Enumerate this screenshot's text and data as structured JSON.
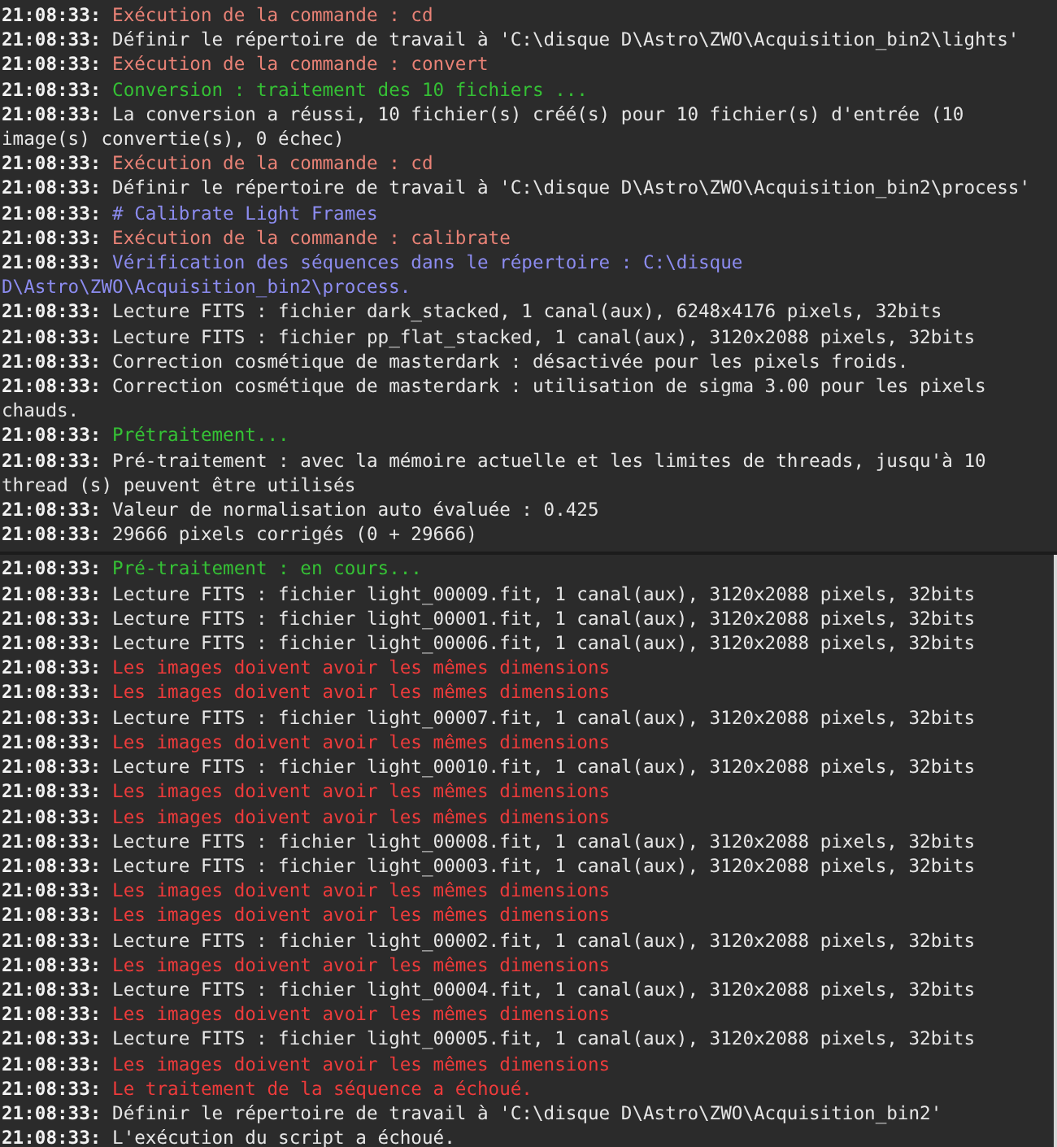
{
  "panels": [
    {
      "lines": [
        {
          "time": "21:08:33:",
          "kind": "command",
          "text": "Exécution de la commande : cd"
        },
        {
          "time": "21:08:33:",
          "kind": "info",
          "text": "Définir le répertoire de travail à 'C:\\disque D\\Astro\\ZWO\\Acquisition_bin2\\lights'"
        },
        {
          "time": "21:08:33:",
          "kind": "command",
          "text": "Exécution de la commande : convert"
        },
        {
          "time": "21:08:33:",
          "kind": "success",
          "text": "Conversion : traitement des 10 fichiers ..."
        },
        {
          "time": "21:08:33:",
          "kind": "info",
          "text": "La conversion a réussi, 10 fichier(s) créé(s) pour 10 fichier(s) d'entrée (10 image(s) convertie(s), 0 échec)"
        },
        {
          "time": "21:08:33:",
          "kind": "command",
          "text": "Exécution de la commande : cd"
        },
        {
          "time": "21:08:33:",
          "kind": "info",
          "text": "Définir le répertoire de travail à 'C:\\disque D\\Astro\\ZWO\\Acquisition_bin2\\process'"
        },
        {
          "time": "21:08:33:",
          "kind": "heading",
          "text": "# Calibrate Light Frames"
        },
        {
          "time": "21:08:33:",
          "kind": "command",
          "text": "Exécution de la commande : calibrate"
        },
        {
          "time": "21:08:33:",
          "kind": "heading",
          "text": "Vérification des séquences dans le répertoire : C:\\disque D\\Astro\\ZWO\\Acquisition_bin2\\process."
        },
        {
          "time": "21:08:33:",
          "kind": "info",
          "text": "Lecture FITS : fichier dark_stacked, 1 canal(aux), 6248x4176 pixels, 32bits"
        },
        {
          "time": "21:08:33:",
          "kind": "info",
          "text": "Lecture FITS : fichier pp_flat_stacked, 1 canal(aux), 3120x2088 pixels, 32bits"
        },
        {
          "time": "21:08:33:",
          "kind": "info",
          "text": "Correction cosmétique de masterdark : désactivée pour les pixels froids."
        },
        {
          "time": "21:08:33:",
          "kind": "info",
          "text": "Correction cosmétique de masterdark : utilisation de sigma 3.00 pour les pixels chauds."
        },
        {
          "time": "21:08:33:",
          "kind": "success",
          "text": "Prétraitement..."
        },
        {
          "time": "21:08:33:",
          "kind": "info",
          "text": "Pré-traitement : avec la mémoire actuelle et les limites de threads, jusqu'à 10 thread (s) peuvent être utilisés"
        },
        {
          "time": "21:08:33:",
          "kind": "info",
          "text": "Valeur de normalisation auto évaluée : 0.425"
        },
        {
          "time": "21:08:33:",
          "kind": "info",
          "text": "29666 pixels corrigés (0 + 29666)"
        }
      ]
    },
    {
      "lines": [
        {
          "time": "21:08:33:",
          "kind": "success",
          "text": "Pré-traitement : en cours..."
        },
        {
          "time": "21:08:33:",
          "kind": "info",
          "text": "Lecture FITS : fichier light_00009.fit, 1 canal(aux), 3120x2088 pixels, 32bits"
        },
        {
          "time": "21:08:33:",
          "kind": "info",
          "text": "Lecture FITS : fichier light_00001.fit, 1 canal(aux), 3120x2088 pixels, 32bits"
        },
        {
          "time": "21:08:33:",
          "kind": "info",
          "text": "Lecture FITS : fichier light_00006.fit, 1 canal(aux), 3120x2088 pixels, 32bits"
        },
        {
          "time": "21:08:33:",
          "kind": "error",
          "text": "Les images doivent avoir les mêmes dimensions"
        },
        {
          "time": "21:08:33:",
          "kind": "error",
          "text": "Les images doivent avoir les mêmes dimensions"
        },
        {
          "time": "21:08:33:",
          "kind": "info",
          "text": "Lecture FITS : fichier light_00007.fit, 1 canal(aux), 3120x2088 pixels, 32bits"
        },
        {
          "time": "21:08:33:",
          "kind": "error",
          "text": "Les images doivent avoir les mêmes dimensions"
        },
        {
          "time": "21:08:33:",
          "kind": "info",
          "text": "Lecture FITS : fichier light_00010.fit, 1 canal(aux), 3120x2088 pixels, 32bits"
        },
        {
          "time": "21:08:33:",
          "kind": "error",
          "text": "Les images doivent avoir les mêmes dimensions"
        },
        {
          "time": "21:08:33:",
          "kind": "error",
          "text": "Les images doivent avoir les mêmes dimensions"
        },
        {
          "time": "21:08:33:",
          "kind": "info",
          "text": "Lecture FITS : fichier light_00008.fit, 1 canal(aux), 3120x2088 pixels, 32bits"
        },
        {
          "time": "21:08:33:",
          "kind": "info",
          "text": "Lecture FITS : fichier light_00003.fit, 1 canal(aux), 3120x2088 pixels, 32bits"
        },
        {
          "time": "21:08:33:",
          "kind": "error",
          "text": "Les images doivent avoir les mêmes dimensions"
        },
        {
          "time": "21:08:33:",
          "kind": "error",
          "text": "Les images doivent avoir les mêmes dimensions"
        },
        {
          "time": "21:08:33:",
          "kind": "info",
          "text": "Lecture FITS : fichier light_00002.fit, 1 canal(aux), 3120x2088 pixels, 32bits"
        },
        {
          "time": "21:08:33:",
          "kind": "error",
          "text": "Les images doivent avoir les mêmes dimensions"
        },
        {
          "time": "21:08:33:",
          "kind": "info",
          "text": "Lecture FITS : fichier light_00004.fit, 1 canal(aux), 3120x2088 pixels, 32bits"
        },
        {
          "time": "21:08:33:",
          "kind": "error",
          "text": "Les images doivent avoir les mêmes dimensions"
        },
        {
          "time": "21:08:33:",
          "kind": "info",
          "text": "Lecture FITS : fichier light_00005.fit, 1 canal(aux), 3120x2088 pixels, 32bits"
        },
        {
          "time": "21:08:33:",
          "kind": "error",
          "text": "Les images doivent avoir les mêmes dimensions"
        },
        {
          "time": "21:08:33:",
          "kind": "error",
          "text": "Le traitement de la séquence a échoué."
        },
        {
          "time": "21:08:33:",
          "kind": "info",
          "text": "Définir le répertoire de travail à 'C:\\disque D\\Astro\\ZWO\\Acquisition_bin2'"
        },
        {
          "time": "21:08:33:",
          "kind": "info",
          "text": "L'exécution du script a échoué."
        }
      ]
    }
  ]
}
